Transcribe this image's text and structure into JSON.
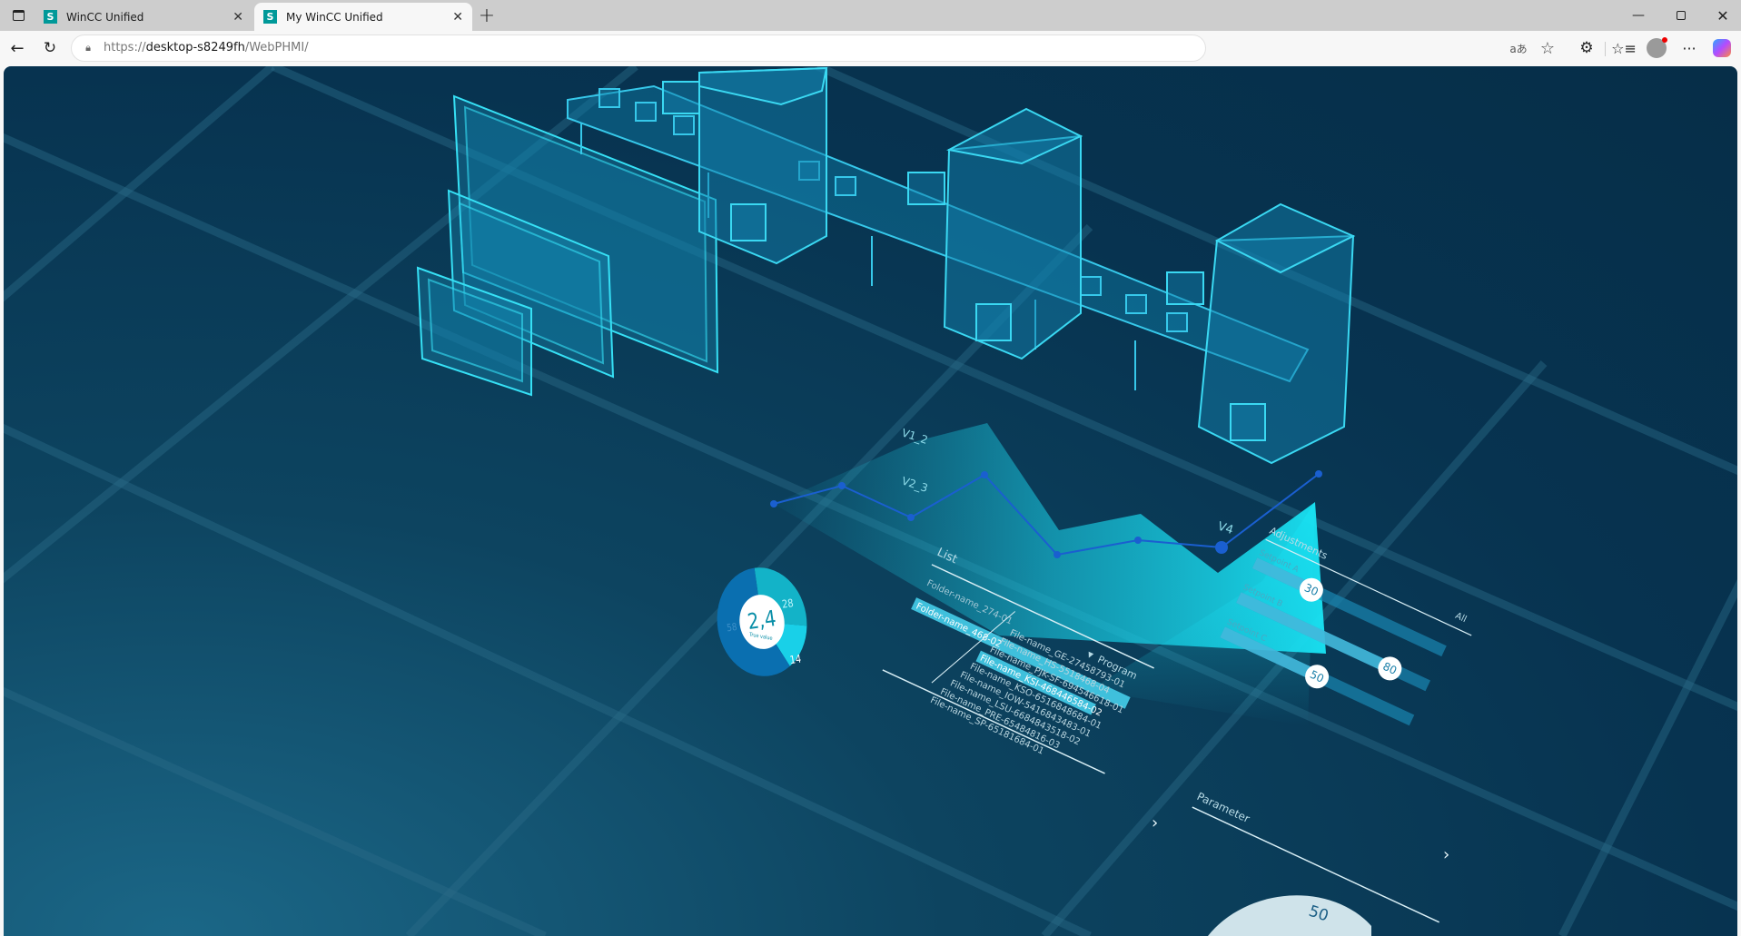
{
  "browser": {
    "tabs": [
      {
        "title": "WinCC Unified",
        "favicon": "S"
      },
      {
        "title": "My WinCC Unified",
        "favicon": "S"
      }
    ],
    "url_prefix": "https://",
    "url_host": "desktop-s8249fh",
    "url_path": "/WebPHMI/",
    "read_aloud_label": "aあ"
  },
  "scene": {
    "chart": {
      "labels": [
        "V1_2",
        "V2_3",
        "V4"
      ],
      "accent": "#19d3e8",
      "line_color": "#1a5fd0"
    },
    "donut": {
      "value": "2,4",
      "caption": "True value",
      "segments": [
        {
          "label": "58",
          "value": 58,
          "color": "#0a6fb0"
        },
        {
          "label": "28",
          "value": 28,
          "color": "#13b3c8"
        },
        {
          "label": "14",
          "value": 14,
          "color": "#19d0e8"
        }
      ]
    },
    "list": {
      "title": "List",
      "folders": [
        "Folder-name_274-01",
        "Folder-name_468-02"
      ],
      "filter": "Program",
      "files": [
        "File-name_GE-27458793-01",
        "File-name_HS-5518468-04",
        "File-name_PJK-SF-694546618-01",
        "File-name_KSI-468446584-02",
        "File-name_KSO-6516848684-01",
        "File-name_IOW-5416843483-01",
        "File-name_LSU-6684843518-02",
        "File-name_PRE-65484816-03",
        "File-name_SP-65181684-01"
      ]
    },
    "adjustments": {
      "title": "Adjustments",
      "filter": "All",
      "setpoints": [
        {
          "label": "Setpoint A",
          "value": "30"
        },
        {
          "label": "Setpoint B",
          "value": "80"
        },
        {
          "label": "Setpoint C",
          "value": "50"
        }
      ]
    },
    "parameter": {
      "title": "Parameter"
    },
    "gauge": {
      "value": "50"
    }
  }
}
